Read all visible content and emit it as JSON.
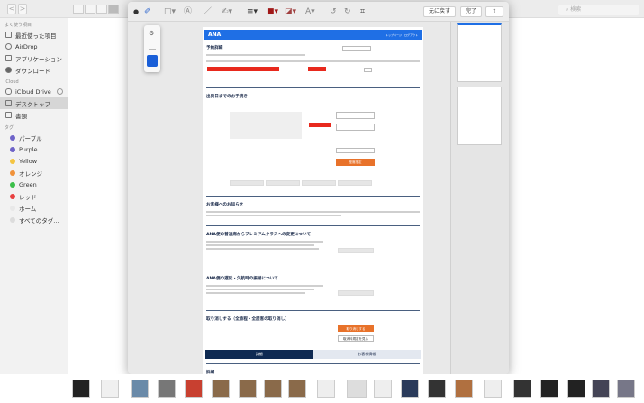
{
  "finder": {
    "search_placeholder": "検索",
    "nav_back": "<",
    "nav_forward": ">"
  },
  "sidebar": {
    "favorites_title": "よく使う項目",
    "favorites": [
      {
        "label": "最近使った項目"
      },
      {
        "label": "AirDrop"
      },
      {
        "label": "アプリケーション"
      },
      {
        "label": "ダウンロード"
      }
    ],
    "icloud_title": "iCloud",
    "icloud": [
      {
        "label": "iCloud Drive"
      },
      {
        "label": "デスクトップ"
      },
      {
        "label": "書類"
      }
    ],
    "tags_title": "タグ",
    "tags": [
      {
        "label": "パープル",
        "color": "#6e63c8"
      },
      {
        "label": "Purple",
        "color": "#6e63c8"
      },
      {
        "label": "Yellow",
        "color": "#f4c542"
      },
      {
        "label": "オレンジ",
        "color": "#f0923a"
      },
      {
        "label": "Green",
        "color": "#3cbf4a"
      },
      {
        "label": "レッド",
        "color": "#e84040"
      },
      {
        "label": "ホーム",
        "color": "#e8e8e8"
      },
      {
        "label": "すべてのタグ...",
        "color": "#dcdcdc"
      }
    ]
  },
  "quicklook": {
    "revert_label": "元に戻す",
    "done_label": "完了",
    "selected_color": "#1a5fd8"
  },
  "doc": {
    "logo": "ANA",
    "header_links": "トップページ　ログアウト",
    "sections": {
      "reservation": "予約詳細",
      "procedures": "出発日までのお手続き",
      "notice": "お客様へのお知らせ",
      "premium": "ANA便の普通席からプレミアムクラスへの変更について",
      "delay": "ANA便の遅延・欠航時の振替について",
      "cancel": "取り消しする（全旅程・全旅客の取り消し）",
      "details": "詳細"
    },
    "buttons": {
      "seat": "座席指定",
      "cancel": "取り消しする",
      "cancel_rules": "取消料規定を見る"
    },
    "tabs": [
      "詳細",
      "お客様情報"
    ]
  }
}
